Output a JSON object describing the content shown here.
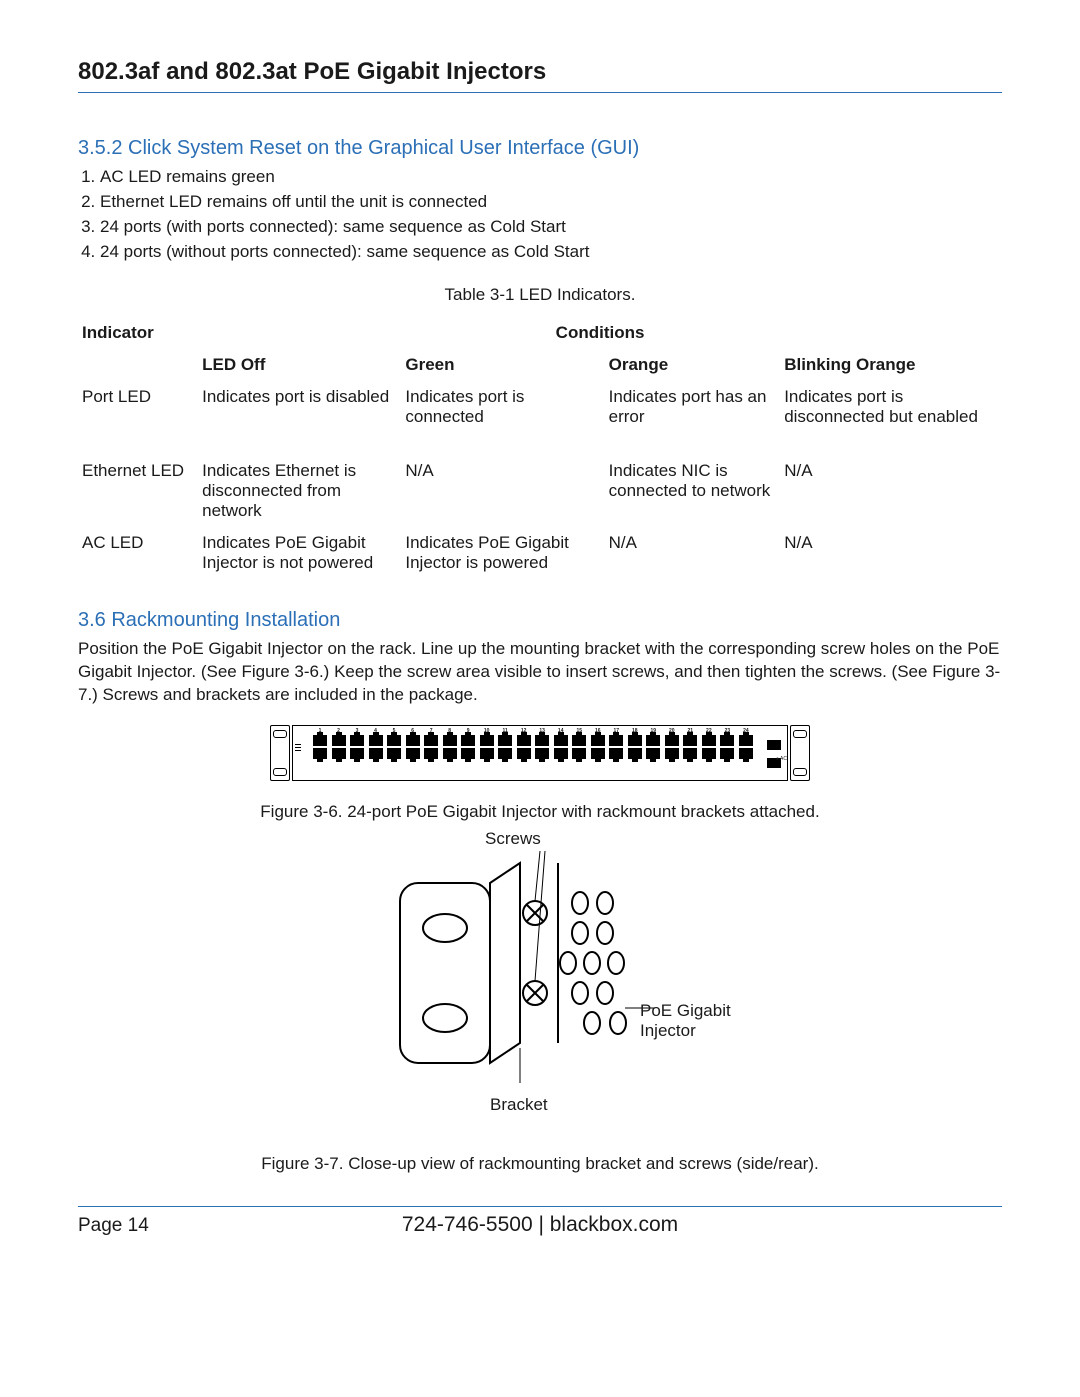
{
  "doc_title": "802.3af and 802.3at PoE Gigabit Injectors",
  "section_352": {
    "heading": "3.5.2 Click System Reset on the Graphical User Interface (GUI)",
    "items": [
      "AC LED remains green",
      "Ethernet LED remains off until the unit is connected",
      "24 ports (with ports connected): same sequence as Cold Start",
      "24 ports (without ports connected): same sequence as Cold Start"
    ]
  },
  "table": {
    "caption": "Table 3-1 LED Indicators.",
    "head_indicator": "Indicator",
    "head_conditions": "Conditions",
    "cols": {
      "off": "LED Off",
      "green": "Green",
      "orange": "Orange",
      "blink": "Blinking Orange"
    },
    "rows": [
      {
        "indicator": "Port LED",
        "off": "Indicates port is disabled",
        "green": "Indicates port is connected",
        "orange": "Indicates port has an error",
        "blink": "Indicates port is disconnected but enabled"
      },
      {
        "indicator": "Ethernet LED",
        "off": "Indicates Ethernet is disconnected from network",
        "green": "N/A",
        "orange": "Indicates NIC is connected to network",
        "blink": "N/A"
      },
      {
        "indicator": "AC LED",
        "off": "Indicates PoE Gigabit Injector is not powered",
        "green": "Indicates PoE Gigabit Injector is powered",
        "orange": "N/A",
        "blink": "N/A"
      }
    ]
  },
  "section_36": {
    "heading": "3.6 Rackmounting Installation",
    "body": "Position the PoE Gigabit Injector on the rack. Line up the mounting bracket with the corresponding screw holes on the PoE Gigabit Injector. (See Figure 3-6.) Keep the screw area visible to insert screws, and then tighten the screws. (See Figure 3-7.) Screws and brackets are included in the package."
  },
  "figure36": {
    "caption": "Figure 3-6. 24-port PoE Gigabit Injector with rackmount brackets attached.",
    "port_numbers": [
      "1",
      "2",
      "3",
      "4",
      "5",
      "6",
      "7",
      "8",
      "9",
      "10",
      "11",
      "12",
      "13",
      "14",
      "15",
      "16",
      "17",
      "18",
      "19",
      "20",
      "21",
      "22",
      "23",
      "24"
    ],
    "ac_label": "AC"
  },
  "figure37": {
    "caption": "Figure 3-7. Close-up view of rackmounting bracket and screws (side/rear).",
    "label_screws": "Screws",
    "label_bracket": "Bracket",
    "label_device": "PoE Gigabit Injector"
  },
  "footer": {
    "page": "Page 14",
    "center": "724-746-5500   |   blackbox.com"
  },
  "colors": {
    "accent": "#2b6fb6"
  }
}
